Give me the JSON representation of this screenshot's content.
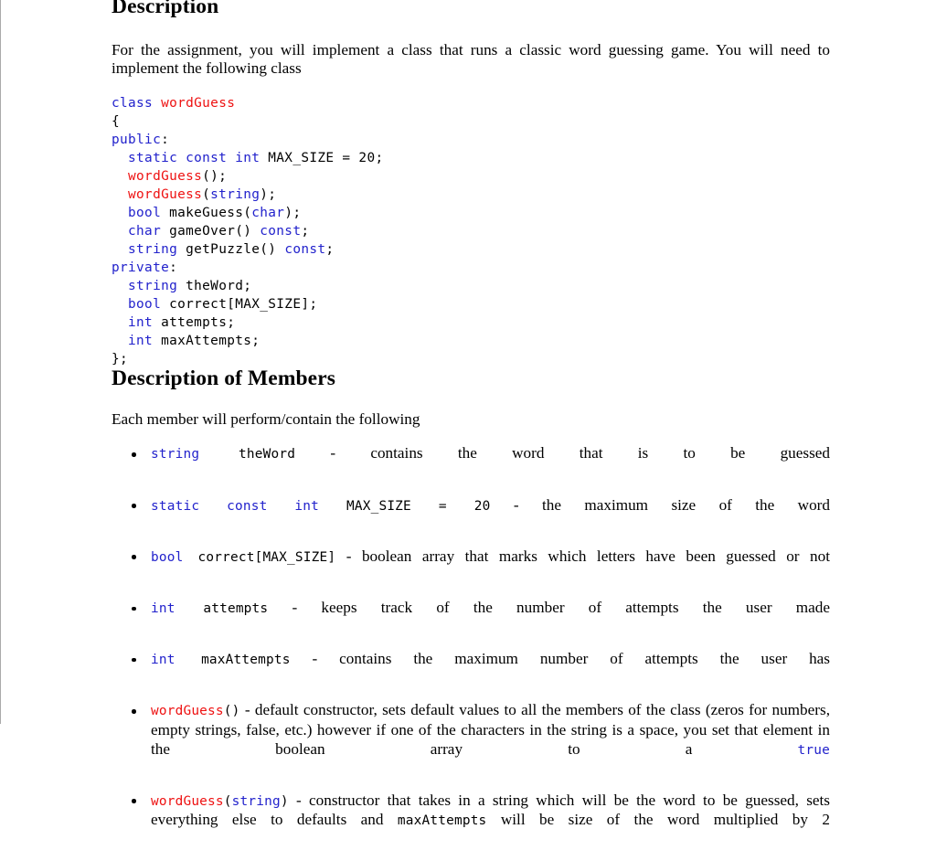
{
  "document": {
    "colors": {
      "keyword_blue": "#2222cc",
      "identifier_red": "#ee1111",
      "body_black": "#000000",
      "page_background": "#ffffff",
      "page_border": "#aaaaaa"
    },
    "sections": {
      "description": {
        "heading": "Description",
        "paragraph": "For the assignment, you will implement a class that runs a classic word guessing game. You will need to implement the following class"
      },
      "members": {
        "heading": "Description of Members",
        "paragraph": "Each member will perform/contain the following"
      }
    },
    "code_listing": {
      "lines": [
        [
          {
            "t": "class",
            "c": "kw"
          },
          {
            "t": " ",
            "c": "pln"
          },
          {
            "t": "wordGuess",
            "c": "cls"
          }
        ],
        [
          {
            "t": "{",
            "c": "pln"
          }
        ],
        [
          {
            "t": "public",
            "c": "kw"
          },
          {
            "t": ":",
            "c": "pln"
          }
        ],
        [
          {
            "t": "  ",
            "c": "pln"
          },
          {
            "t": "static const int",
            "c": "kw"
          },
          {
            "t": " MAX_SIZE = 20;",
            "c": "pln"
          }
        ],
        [
          {
            "t": "  ",
            "c": "pln"
          },
          {
            "t": "wordGuess",
            "c": "cls"
          },
          {
            "t": "();",
            "c": "pln"
          }
        ],
        [
          {
            "t": "  ",
            "c": "pln"
          },
          {
            "t": "wordGuess",
            "c": "cls"
          },
          {
            "t": "(",
            "c": "pln"
          },
          {
            "t": "string",
            "c": "kw"
          },
          {
            "t": ");",
            "c": "pln"
          }
        ],
        [
          {
            "t": "  ",
            "c": "pln"
          },
          {
            "t": "bool",
            "c": "kw"
          },
          {
            "t": " makeGuess(",
            "c": "pln"
          },
          {
            "t": "char",
            "c": "kw"
          },
          {
            "t": ");",
            "c": "pln"
          }
        ],
        [
          {
            "t": "  ",
            "c": "pln"
          },
          {
            "t": "char",
            "c": "kw"
          },
          {
            "t": " gameOver() ",
            "c": "pln"
          },
          {
            "t": "const",
            "c": "kw"
          },
          {
            "t": ";",
            "c": "pln"
          }
        ],
        [
          {
            "t": "  ",
            "c": "pln"
          },
          {
            "t": "string",
            "c": "kw"
          },
          {
            "t": " getPuzzle() ",
            "c": "pln"
          },
          {
            "t": "const",
            "c": "kw"
          },
          {
            "t": ";",
            "c": "pln"
          }
        ],
        [
          {
            "t": "private",
            "c": "kw"
          },
          {
            "t": ":",
            "c": "pln"
          }
        ],
        [
          {
            "t": "  ",
            "c": "pln"
          },
          {
            "t": "string",
            "c": "kw"
          },
          {
            "t": " theWord;",
            "c": "pln"
          }
        ],
        [
          {
            "t": "  ",
            "c": "pln"
          },
          {
            "t": "bool",
            "c": "kw"
          },
          {
            "t": " correct[MAX_SIZE];",
            "c": "pln"
          }
        ],
        [
          {
            "t": "  ",
            "c": "pln"
          },
          {
            "t": "int",
            "c": "kw"
          },
          {
            "t": " attempts;",
            "c": "pln"
          }
        ],
        [
          {
            "t": "  ",
            "c": "pln"
          },
          {
            "t": "int",
            "c": "kw"
          },
          {
            "t": " maxAttempts;",
            "c": "pln"
          }
        ],
        [
          {
            "t": "};",
            "c": "pln"
          }
        ]
      ]
    },
    "members_list": [
      {
        "name": "member-string-theword",
        "parts": [
          {
            "t": "string",
            "k": "code",
            "c": "kw"
          },
          {
            "t": " theWord",
            "k": "code",
            "c": "pln"
          },
          {
            "t": " - contains the word that is to be guessed",
            "k": "text"
          }
        ]
      },
      {
        "name": "member-max-size",
        "parts": [
          {
            "t": "static const int",
            "k": "code",
            "c": "kw"
          },
          {
            "t": " MAX_SIZE = 20",
            "k": "code",
            "c": "pln"
          },
          {
            "t": " - the maximum size of the word",
            "k": "text"
          }
        ]
      },
      {
        "name": "member-bool-correct",
        "parts": [
          {
            "t": "bool",
            "k": "code",
            "c": "kw"
          },
          {
            "t": " correct[MAX_SIZE]",
            "k": "code",
            "c": "pln"
          },
          {
            "t": " - boolean array that marks which letters have been guessed or not",
            "k": "text"
          }
        ]
      },
      {
        "name": "member-int-attempts",
        "parts": [
          {
            "t": "int",
            "k": "code",
            "c": "kw"
          },
          {
            "t": " attempts",
            "k": "code",
            "c": "pln"
          },
          {
            "t": " - keeps track of the number of attempts the user made",
            "k": "text"
          }
        ]
      },
      {
        "name": "member-int-maxattempts",
        "parts": [
          {
            "t": "int",
            "k": "code",
            "c": "kw"
          },
          {
            "t": " maxAttempts",
            "k": "code",
            "c": "pln"
          },
          {
            "t": " - contains the maximum number of attempts the user has",
            "k": "text"
          }
        ]
      },
      {
        "name": "member-default-constructor",
        "parts": [
          {
            "t": "wordGuess",
            "k": "code",
            "c": "cls"
          },
          {
            "t": "()",
            "k": "code",
            "c": "pln"
          },
          {
            "t": " - default constructor, sets default values to all the members of the class (zeros for numbers, empty strings, false, etc.) however if one of the characters in the string is a space, you set that element in the boolean array to a ",
            "k": "text"
          },
          {
            "t": "true",
            "k": "code",
            "c": "kw"
          }
        ]
      },
      {
        "name": "member-string-constructor",
        "parts": [
          {
            "t": "wordGuess",
            "k": "code",
            "c": "cls"
          },
          {
            "t": "(",
            "k": "code",
            "c": "pln"
          },
          {
            "t": "string",
            "k": "code",
            "c": "kw"
          },
          {
            "t": ")",
            "k": "code",
            "c": "pln"
          },
          {
            "t": " - constructor that takes in a string which will be the word to be guessed, sets everything else to defaults and ",
            "k": "text"
          },
          {
            "t": "maxAttempts",
            "k": "code",
            "c": "pln"
          },
          {
            "t": " will be size of the word multiplied by 2",
            "k": "text"
          }
        ]
      }
    ]
  }
}
